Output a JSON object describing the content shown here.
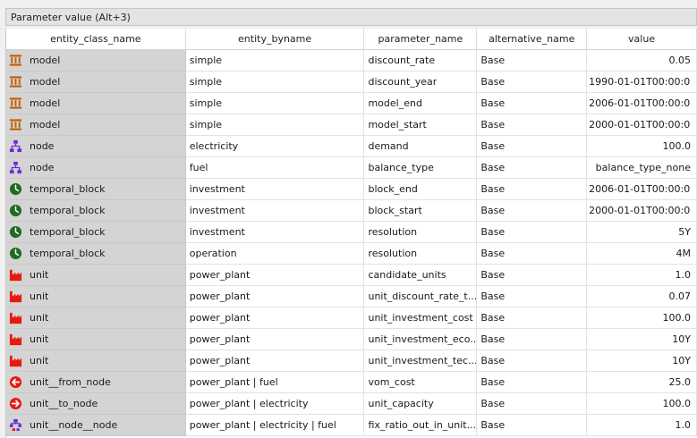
{
  "dock": {
    "title": "Parameter value (Alt+3)"
  },
  "columns": [
    "entity_class_name",
    "entity_byname",
    "parameter_name",
    "alternative_name",
    "value"
  ],
  "rows": [
    {
      "icon": "model-icon",
      "cells": [
        "model",
        "simple",
        "discount_rate",
        "Base",
        "0.05"
      ]
    },
    {
      "icon": "model-icon",
      "cells": [
        "model",
        "simple",
        "discount_year",
        "Base",
        "1990-01-01T00:00:00"
      ]
    },
    {
      "icon": "model-icon",
      "cells": [
        "model",
        "simple",
        "model_end",
        "Base",
        "2006-01-01T00:00:00"
      ]
    },
    {
      "icon": "model-icon",
      "cells": [
        "model",
        "simple",
        "model_start",
        "Base",
        "2000-01-01T00:00:00"
      ]
    },
    {
      "icon": "node-icon",
      "cells": [
        "node",
        "electricity",
        "demand",
        "Base",
        "100.0"
      ]
    },
    {
      "icon": "node-icon",
      "cells": [
        "node",
        "fuel",
        "balance_type",
        "Base",
        "balance_type_none"
      ]
    },
    {
      "icon": "clock-icon",
      "cells": [
        "temporal_block",
        "investment",
        "block_end",
        "Base",
        "2006-01-01T00:00:00"
      ]
    },
    {
      "icon": "clock-icon",
      "cells": [
        "temporal_block",
        "investment",
        "block_start",
        "Base",
        "2000-01-01T00:00:00"
      ]
    },
    {
      "icon": "clock-icon",
      "cells": [
        "temporal_block",
        "investment",
        "resolution",
        "Base",
        "5Y"
      ]
    },
    {
      "icon": "clock-icon",
      "cells": [
        "temporal_block",
        "operation",
        "resolution",
        "Base",
        "4M"
      ]
    },
    {
      "icon": "factory-icon",
      "cells": [
        "unit",
        "power_plant",
        "candidate_units",
        "Base",
        "1.0"
      ]
    },
    {
      "icon": "factory-icon",
      "cells": [
        "unit",
        "power_plant",
        "unit_discount_rate_t...",
        "Base",
        "0.07"
      ]
    },
    {
      "icon": "factory-icon",
      "cells": [
        "unit",
        "power_plant",
        "unit_investment_cost",
        "Base",
        "100.0"
      ]
    },
    {
      "icon": "factory-icon",
      "cells": [
        "unit",
        "power_plant",
        "unit_investment_eco...",
        "Base",
        "10Y"
      ]
    },
    {
      "icon": "factory-icon",
      "cells": [
        "unit",
        "power_plant",
        "unit_investment_tec...",
        "Base",
        "10Y"
      ]
    },
    {
      "icon": "arrow-left-icon",
      "cells": [
        "unit__from_node",
        "power_plant | fuel",
        "vom_cost",
        "Base",
        "25.0"
      ]
    },
    {
      "icon": "arrow-right-icon",
      "cells": [
        "unit__to_node",
        "power_plant | electricity",
        "unit_capacity",
        "Base",
        "100.0"
      ]
    },
    {
      "icon": "node-node-icon",
      "cells": [
        "unit__node__node",
        "power_plant | electricity | fuel",
        "fix_ratio_out_in_unit...",
        "Base",
        "1.0"
      ]
    }
  ]
}
